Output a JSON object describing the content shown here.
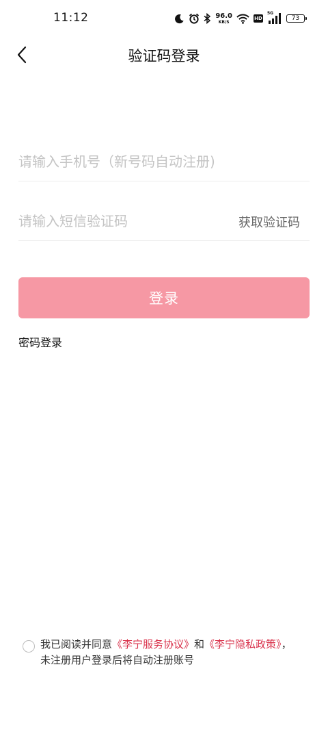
{
  "status_bar": {
    "time": "11:12",
    "net_speed_value": "96.0",
    "net_speed_unit": "KB/S",
    "hd_label": "HD",
    "network_label": "5G",
    "battery_level": "73",
    "icons": [
      "moon-icon",
      "alarm-icon",
      "bluetooth-icon",
      "wifi-icon",
      "signal-icon",
      "battery-icon"
    ]
  },
  "header": {
    "title": "验证码登录",
    "back_icon": "chevron-left-icon"
  },
  "form": {
    "phone_placeholder": "请输入手机号（新号码自动注册)",
    "code_placeholder": "请输入短信验证码",
    "get_code_label": "获取验证码",
    "login_label": "登录",
    "password_login_label": "密码登录"
  },
  "agreement": {
    "prefix": "我已阅读并同意",
    "service_link": "《李宁服务协议》",
    "conjunction": "和",
    "privacy_link": "《李宁隐私政策》",
    "suffix": "，未注册用户登录后将自动注册账号"
  },
  "colors": {
    "accent_link": "#d9304a",
    "login_button_bg": "#f698a4",
    "placeholder": "#c4c4c4"
  }
}
